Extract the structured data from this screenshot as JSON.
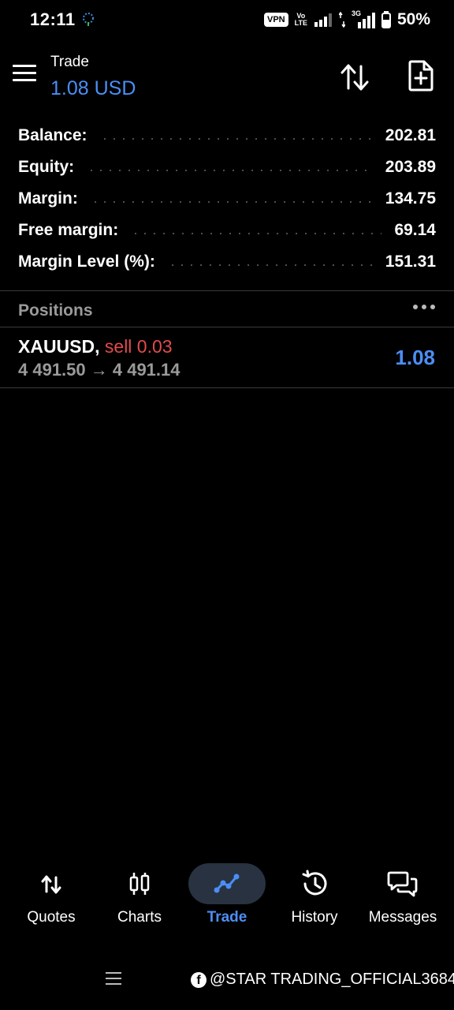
{
  "status_bar": {
    "time": "12:11",
    "vpn": "VPN",
    "volte_top": "Vo",
    "volte_bottom": "LTE",
    "network": "3G",
    "battery": "50%"
  },
  "header": {
    "title": "Trade",
    "subtitle": "1.08 USD",
    "icons": [
      "menu-icon",
      "sort-icon",
      "new-order-icon"
    ]
  },
  "account": [
    {
      "label": "Balance:",
      "value": "202.81"
    },
    {
      "label": "Equity:",
      "value": "203.89"
    },
    {
      "label": "Margin:",
      "value": "134.75"
    },
    {
      "label": "Free margin:",
      "value": "69.14"
    },
    {
      "label": "Margin Level (%):",
      "value": "151.31"
    }
  ],
  "positions": {
    "title": "Positions",
    "items": [
      {
        "symbol": "XAUUSD,",
        "side": "sell 0.03",
        "prices": "4 491.50 → 4 491.14",
        "profit": "1.08"
      }
    ]
  },
  "bottom_nav": [
    {
      "label": "Quotes",
      "icon": "quotes-icon",
      "active": false
    },
    {
      "label": "Charts",
      "icon": "charts-icon",
      "active": false
    },
    {
      "label": "Trade",
      "icon": "trade-icon",
      "active": true
    },
    {
      "label": "History",
      "icon": "history-icon",
      "active": false
    },
    {
      "label": "Messages",
      "icon": "messages-icon",
      "active": false
    }
  ],
  "watermark": "@STAR TRADING_OFFICIAL3684",
  "colors": {
    "accent": "#4b8ef5",
    "sell": "#e24b4b",
    "background": "#000000",
    "muted": "#9a9a9a"
  }
}
